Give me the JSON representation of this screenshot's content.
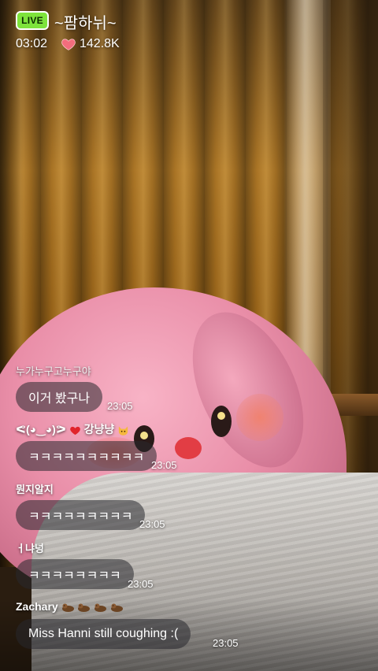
{
  "header": {
    "live_label": "LIVE",
    "channel_title": "~팜하뉘~",
    "elapsed_time": "03:02",
    "likes_count": "142.8K",
    "accent_live": "#7ee33c",
    "heart_color": "#f26d7d"
  },
  "chat": {
    "messages": [
      {
        "author": "누가누구고누구야",
        "text": "이거 봤구나",
        "time": "23:05"
      },
      {
        "author_prefix": "ᕙ(◕‿◕)ᕗ",
        "author": "강냥냥",
        "author_icons": [
          "red-heart-icon",
          "cat-face-icon"
        ],
        "text": "ㅋㅋㅋㅋㅋㅋㅋㅋㅋㅋ",
        "time": "23:05"
      },
      {
        "author": "뭔지알지",
        "text": "ㅋㅋㅋㅋㅋㅋㅋㅋㅋ",
        "time": "23:05"
      },
      {
        "author": "ㅓ냐넝",
        "text": "ㅋㅋㅋㅋㅋㅋㅋㅋ",
        "time": "23:05"
      },
      {
        "author": "Zachary",
        "author_icons": [
          "otter-icon",
          "otter-icon",
          "otter-icon",
          "otter-icon"
        ],
        "text": "Miss Hanni still coughing :(",
        "time": "23:05"
      }
    ]
  }
}
